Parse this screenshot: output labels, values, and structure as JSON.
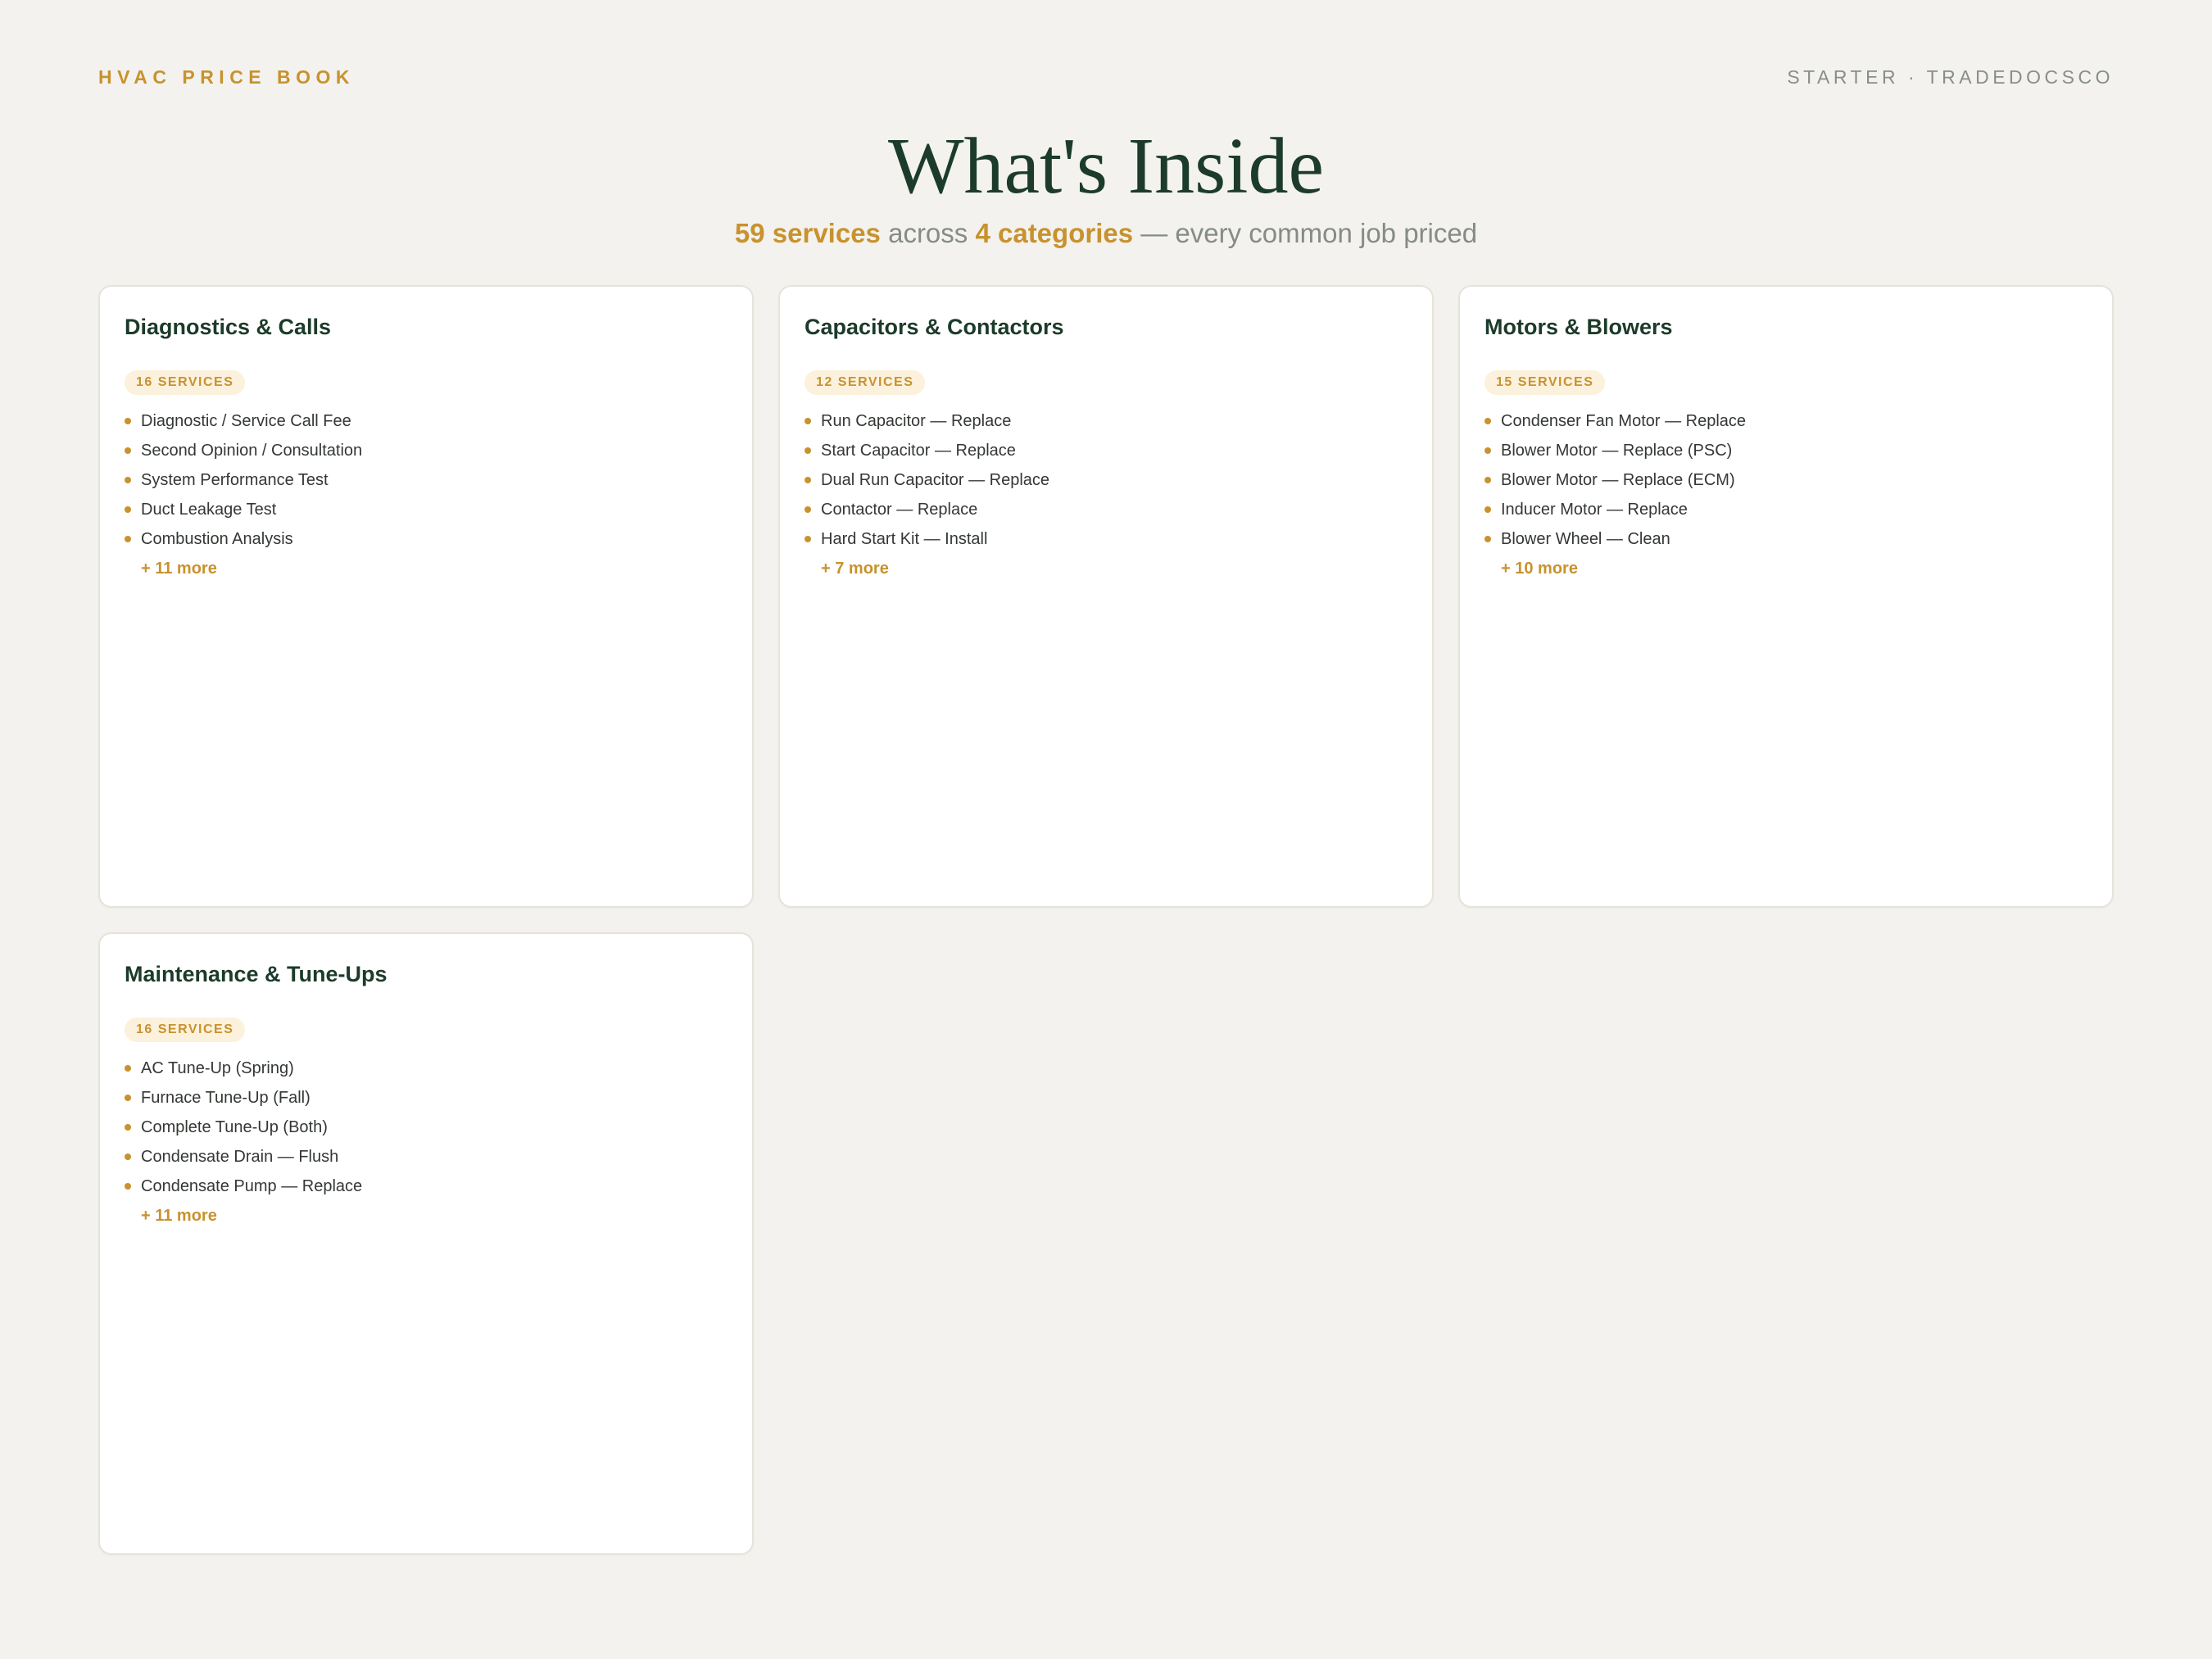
{
  "header": {
    "brand": "HVAC PRICE BOOK",
    "meta": "STARTER · TRADEDOCSCO"
  },
  "title": "What's Inside",
  "subtitle": {
    "services": "59 services",
    "across": " across ",
    "categories": "4 categories",
    "tail": " — every common job priced"
  },
  "colors": {
    "accent": "#c8922e",
    "heading": "#1c3b2a",
    "background": "#f3f2ee",
    "badge_bg": "#fcf1dc"
  },
  "cards": [
    {
      "title": "Diagnostics & Calls",
      "badge": "16 SERVICES",
      "items": [
        "Diagnostic / Service Call Fee",
        "Second Opinion / Consultation",
        "System Performance Test",
        "Duct Leakage Test",
        "Combustion Analysis"
      ],
      "more": "+ 11 more"
    },
    {
      "title": "Capacitors & Contactors",
      "badge": "12 SERVICES",
      "items": [
        "Run Capacitor — Replace",
        "Start Capacitor — Replace",
        "Dual Run Capacitor — Replace",
        "Contactor — Replace",
        "Hard Start Kit — Install"
      ],
      "more": "+ 7 more"
    },
    {
      "title": "Motors & Blowers",
      "badge": "15 SERVICES",
      "items": [
        "Condenser Fan Motor — Replace",
        "Blower Motor — Replace (PSC)",
        "Blower Motor — Replace (ECM)",
        "Inducer Motor — Replace",
        "Blower Wheel — Clean"
      ],
      "more": "+ 10 more"
    },
    {
      "title": "Maintenance & Tune-Ups",
      "badge": "16 SERVICES",
      "items": [
        "AC Tune-Up (Spring)",
        "Furnace Tune-Up (Fall)",
        "Complete Tune-Up (Both)",
        "Condensate Drain — Flush",
        "Condensate Pump — Replace"
      ],
      "more": "+ 11 more"
    }
  ]
}
